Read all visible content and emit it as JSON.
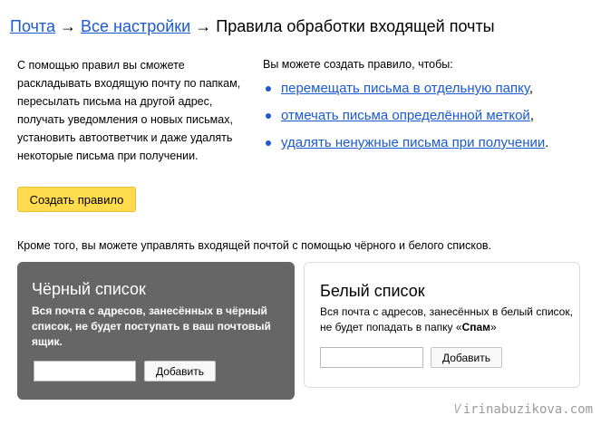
{
  "breadcrumb": {
    "mail": "Почта",
    "arrow": "→",
    "settings": "Все настройки",
    "current": "Правила обработки входящей почты"
  },
  "intro": {
    "text": "С помощью правил вы сможете раскладывать входящую почту по папкам, пересылать письма на другой адрес, получать уведомления о новых письмах, установить автоответчик и даже удалять некоторые письма при получении."
  },
  "create_button": {
    "label": "Создать правило"
  },
  "can_create": {
    "title": "Вы можете создать правило, чтобы:",
    "items": [
      {
        "link": "перемещать письма в отдельную папку",
        "suffix": ","
      },
      {
        "link": "отмечать письма определённой меткой",
        "suffix": ","
      },
      {
        "link": "удалять ненужные письма при получении",
        "suffix": "."
      }
    ]
  },
  "lists_intro": "Кроме того, вы можете управлять входящей почтой с помощью чёрного и белого списков.",
  "blacklist": {
    "title": "Чёрный список",
    "description": "Вся почта с адресов, занесённых в чёрный список, не будет поступать в ваш почтовый ящик.",
    "input_value": "",
    "add_label": "Добавить"
  },
  "whitelist": {
    "title": "Белый список",
    "description_before": "Вся почта с адресов, занесённых в белый список, не будет попадать в папку «",
    "description_bold": "Спам",
    "description_after": "»",
    "input_value": "",
    "add_label": "Добавить"
  },
  "watermark": {
    "icon": "V",
    "text": "irinabuzikova.com"
  },
  "colors": {
    "link": "#1a5ad2",
    "primary_button": "#ffdb4d",
    "blacklist_bg": "#666666"
  }
}
